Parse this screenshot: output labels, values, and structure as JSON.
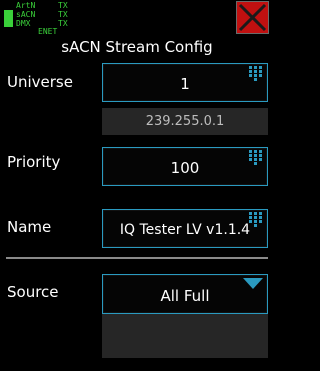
{
  "status": {
    "rows": [
      {
        "label": "ArtN",
        "value": "TX"
      },
      {
        "label": "sACN",
        "value": "TX"
      },
      {
        "label": "DMX",
        "value": "TX"
      }
    ],
    "enet": "ENET",
    "color": "#3ad03a"
  },
  "header": {
    "title": "sACN Stream Config",
    "close_icon": "close-icon",
    "close_color": "#c01010"
  },
  "universe": {
    "label": "Universe",
    "value": "1",
    "multicast_address": "239.255.0.1"
  },
  "priority": {
    "label": "Priority",
    "value": "100"
  },
  "name": {
    "label": "Name",
    "value": "IQ Tester LV v1.1.4"
  },
  "source": {
    "label": "Source",
    "selected": "All Full"
  },
  "colors": {
    "accent": "#2a9ac0",
    "readonly_bg": "#262626"
  }
}
